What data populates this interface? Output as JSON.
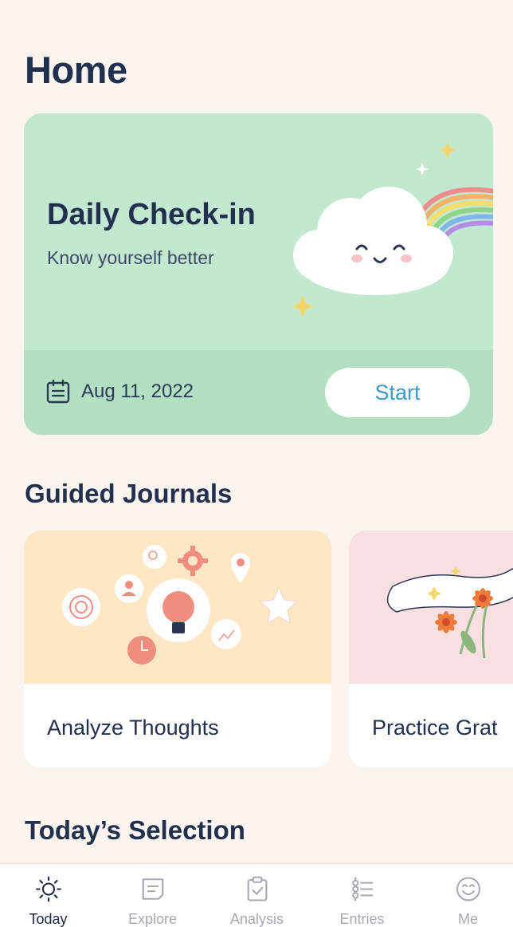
{
  "page": {
    "title": "Home"
  },
  "checkin": {
    "title": "Daily Check-in",
    "subtitle": "Know yourself better",
    "date": "Aug 11, 2022",
    "start_label": "Start"
  },
  "guided_journals": {
    "title": "Guided Journals",
    "cards": [
      {
        "label": "Analyze Thoughts",
        "bg": "#fde7c4"
      },
      {
        "label": "Practice Grat",
        "bg": "#f8dfe1"
      }
    ]
  },
  "todays_selection": {
    "title": "Today’s Selection"
  },
  "nav": {
    "items": [
      {
        "label": "Today",
        "icon": "sun-icon",
        "active": true
      },
      {
        "label": "Explore",
        "icon": "chat-bubble-icon",
        "active": false
      },
      {
        "label": "Analysis",
        "icon": "clipboard-check-icon",
        "active": false
      },
      {
        "label": "Entries",
        "icon": "list-icon",
        "active": false
      },
      {
        "label": "Me",
        "icon": "smiley-icon",
        "active": false
      }
    ]
  },
  "colors": {
    "background": "#fbf4ef",
    "checkin_card": "#c2e9cf",
    "checkin_footer": "#b3e0c3",
    "accent_blue": "#3e9ac6",
    "title_navy": "#22304f"
  }
}
